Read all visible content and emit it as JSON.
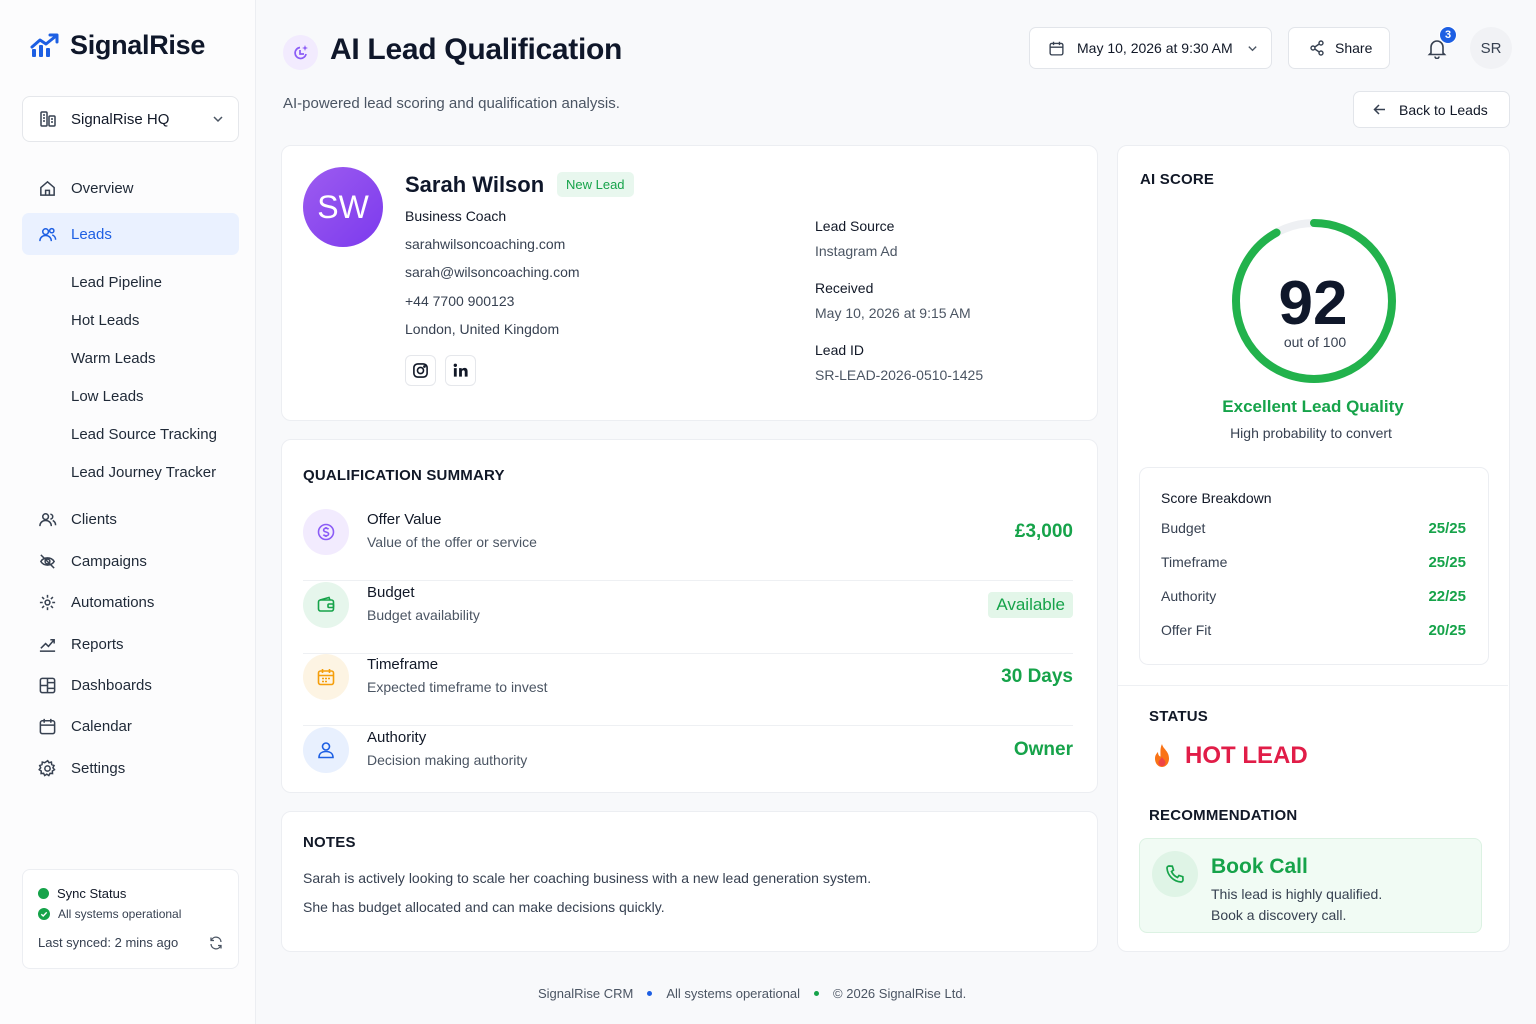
{
  "brand": {
    "name": "SignalRise",
    "accent": "#1d5fe3"
  },
  "workspace": {
    "label": "SignalRise HQ"
  },
  "nav": {
    "overview": "Overview",
    "leads": "Leads",
    "sub": [
      "Lead Pipeline",
      "Hot Leads",
      "Warm Leads",
      "Low Leads",
      "Lead Source Tracking",
      "Lead Journey Tracker"
    ],
    "clients": "Clients",
    "campaigns": "Campaigns",
    "automations": "Automations",
    "reports": "Reports",
    "dashboards": "Dashboards",
    "calendar": "Calendar",
    "settings": "Settings"
  },
  "sync": {
    "title": "Sync Status",
    "status": "All systems operational",
    "last": "Last synced: 2 mins ago"
  },
  "header": {
    "title": "AI Lead Qualification",
    "subtitle": "AI-powered lead scoring and qualification analysis.",
    "date": "May 10, 2026 at 9:30 AM",
    "share": "Share",
    "notifications": "3",
    "user_initials": "SR",
    "back": "Back to Leads"
  },
  "lead": {
    "initials": "SW",
    "name": "Sarah Wilson",
    "badge": "New Lead",
    "role": "Business Coach",
    "website": "sarahwilsoncoaching.com",
    "email": "sarah@wilsoncoaching.com",
    "phone": "+44 7700 900123",
    "location": "London, United Kingdom",
    "source_label": "Lead Source",
    "source": "Instagram Ad",
    "received_label": "Received",
    "received": "May 10, 2026 at 9:15 AM",
    "id_label": "Lead ID",
    "id": "SR-LEAD-2026-0510-1425"
  },
  "qualification": {
    "title": "QUALIFICATION SUMMARY",
    "rows": [
      {
        "title": "Offer Value",
        "desc": "Value of the offer or service",
        "value": "£3,000"
      },
      {
        "title": "Budget",
        "desc": "Budget availability",
        "value": "Available"
      },
      {
        "title": "Timeframe",
        "desc": "Expected timeframe to invest",
        "value": "30 Days"
      },
      {
        "title": "Authority",
        "desc": "Decision making authority",
        "value": "Owner"
      }
    ]
  },
  "notes": {
    "title": "NOTES",
    "lines": [
      "Sarah is actively looking to scale her coaching business with a new lead generation system.",
      "She has budget allocated and can make decisions quickly."
    ]
  },
  "score": {
    "title": "AI SCORE",
    "value": 92,
    "max_label": "out of 100",
    "fraction": 0.92,
    "quality": "Excellent Lead Quality",
    "quality_sub": "High probability to convert",
    "breakdown_title": "Score Breakdown",
    "breakdown": [
      {
        "label": "Budget",
        "value": "25/25"
      },
      {
        "label": "Timeframe",
        "value": "25/25"
      },
      {
        "label": "Authority",
        "value": "22/25"
      },
      {
        "label": "Offer Fit",
        "value": "20/25"
      }
    ],
    "status_title": "STATUS",
    "status": "HOT LEAD",
    "rec_title": "RECOMMENDATION",
    "rec_action": "Book Call",
    "rec_lines": [
      "This lead is highly qualified.",
      "Book a discovery call."
    ]
  },
  "footer": {
    "product": "SignalRise CRM",
    "status": "All systems operational",
    "copyright": "© 2026 SignalRise Ltd."
  }
}
